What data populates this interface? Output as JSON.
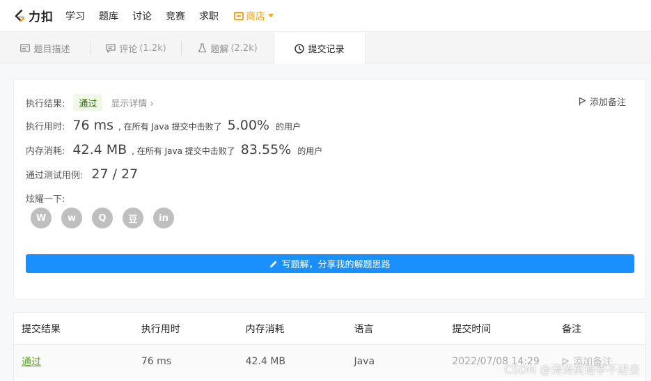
{
  "nav": {
    "logo_text": "力扣",
    "items": [
      "学习",
      "题库",
      "讨论",
      "竞赛",
      "求职"
    ],
    "shop": "商店"
  },
  "tabs": [
    {
      "label": "题目描述",
      "count": ""
    },
    {
      "label": "评论",
      "count": "(1.2k)"
    },
    {
      "label": "题解",
      "count": "(2.2k)"
    },
    {
      "label": "提交记录",
      "count": ""
    }
  ],
  "result": {
    "status_label": "执行结果:",
    "status": "通过",
    "detail_link": "显示详情 ›",
    "add_note": "添加备注",
    "runtime_label": "执行用时:",
    "runtime": "76 ms",
    "runtime_mid": ", 在所有 Java 提交中击败了",
    "runtime_pct": "5.00%",
    "runtime_suffix": "的用户",
    "memory_label": "内存消耗:",
    "memory": "42.4 MB",
    "memory_mid": ", 在所有 Java 提交中击败了",
    "memory_pct": "83.55%",
    "memory_suffix": "的用户",
    "tests_label": "通过测试用例:",
    "tests": "27 / 27",
    "share_label": "炫耀一下:",
    "share_icons": [
      "wechat-icon",
      "weibo-icon",
      "qq-icon",
      "douban-icon",
      "linkedin-icon"
    ],
    "share_glyphs": [
      "W",
      "w",
      "Q",
      "豆",
      "in"
    ],
    "write_button": "写题解，分享我的解题思路"
  },
  "table": {
    "headers": [
      "提交结果",
      "执行用时",
      "内存消耗",
      "语言",
      "提交时间",
      "备注"
    ],
    "rows": [
      {
        "result": "通过",
        "runtime": "76 ms",
        "memory": "42.4 MB",
        "language": "Java",
        "time": "2022/07/08 14:29",
        "note": "添加备注"
      }
    ]
  },
  "watermark": "CSDN @涛涛英语学不进去",
  "colors": {
    "accent": "#1a90ff",
    "pass": "#5aa91e",
    "shop": "#ffa116"
  }
}
